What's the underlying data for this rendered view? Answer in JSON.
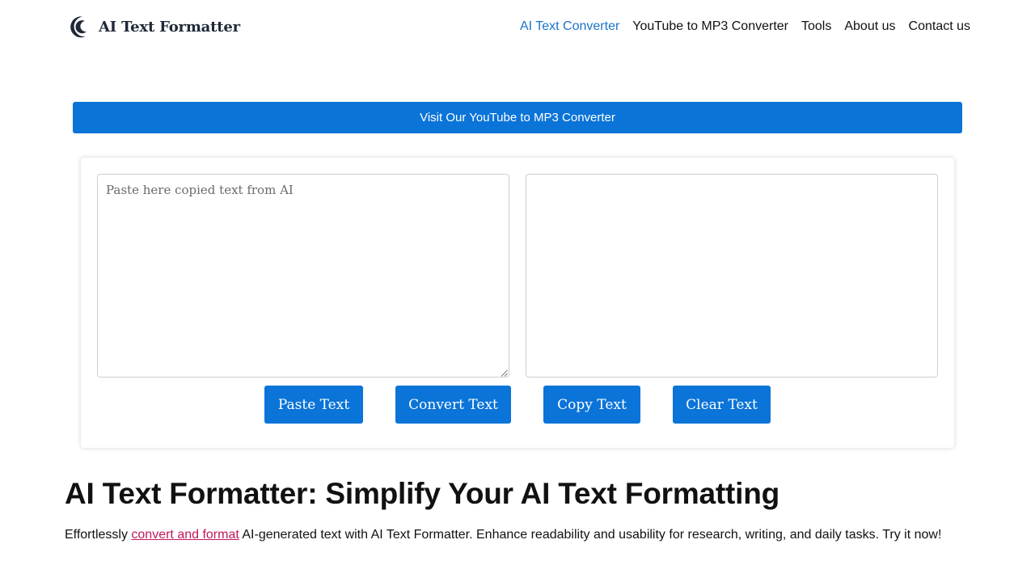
{
  "header": {
    "brand": "AI Text Formatter",
    "logo_icon": "crescent-moon-logo-icon",
    "nav": [
      {
        "label": "AI Text Converter",
        "active": true
      },
      {
        "label": "YouTube to MP3 Converter",
        "active": false
      },
      {
        "label": "Tools",
        "active": false
      },
      {
        "label": "About us",
        "active": false
      },
      {
        "label": "Contact us",
        "active": false
      }
    ]
  },
  "promo": {
    "label": "Visit Our YouTube to MP3 Converter"
  },
  "editor": {
    "input_placeholder": "Paste here copied text from AI",
    "input_value": "",
    "output_value": "",
    "buttons": {
      "paste": "Paste Text",
      "convert": "Convert Text",
      "copy": "Copy Text",
      "clear": "Clear Text"
    }
  },
  "content": {
    "headline": "AI Text Formatter: Simplify Your AI Text Formatting",
    "intro_before": "Effortlessly ",
    "intro_link": "convert and format",
    "intro_after": " AI-generated text with AI Text Formatter. Enhance readability and usability for research, writing, and daily tasks. Try it now!"
  },
  "colors": {
    "accent": "#0b74d8",
    "nav_active": "#1a73c8",
    "link": "#c2185b",
    "text": "#111111"
  }
}
